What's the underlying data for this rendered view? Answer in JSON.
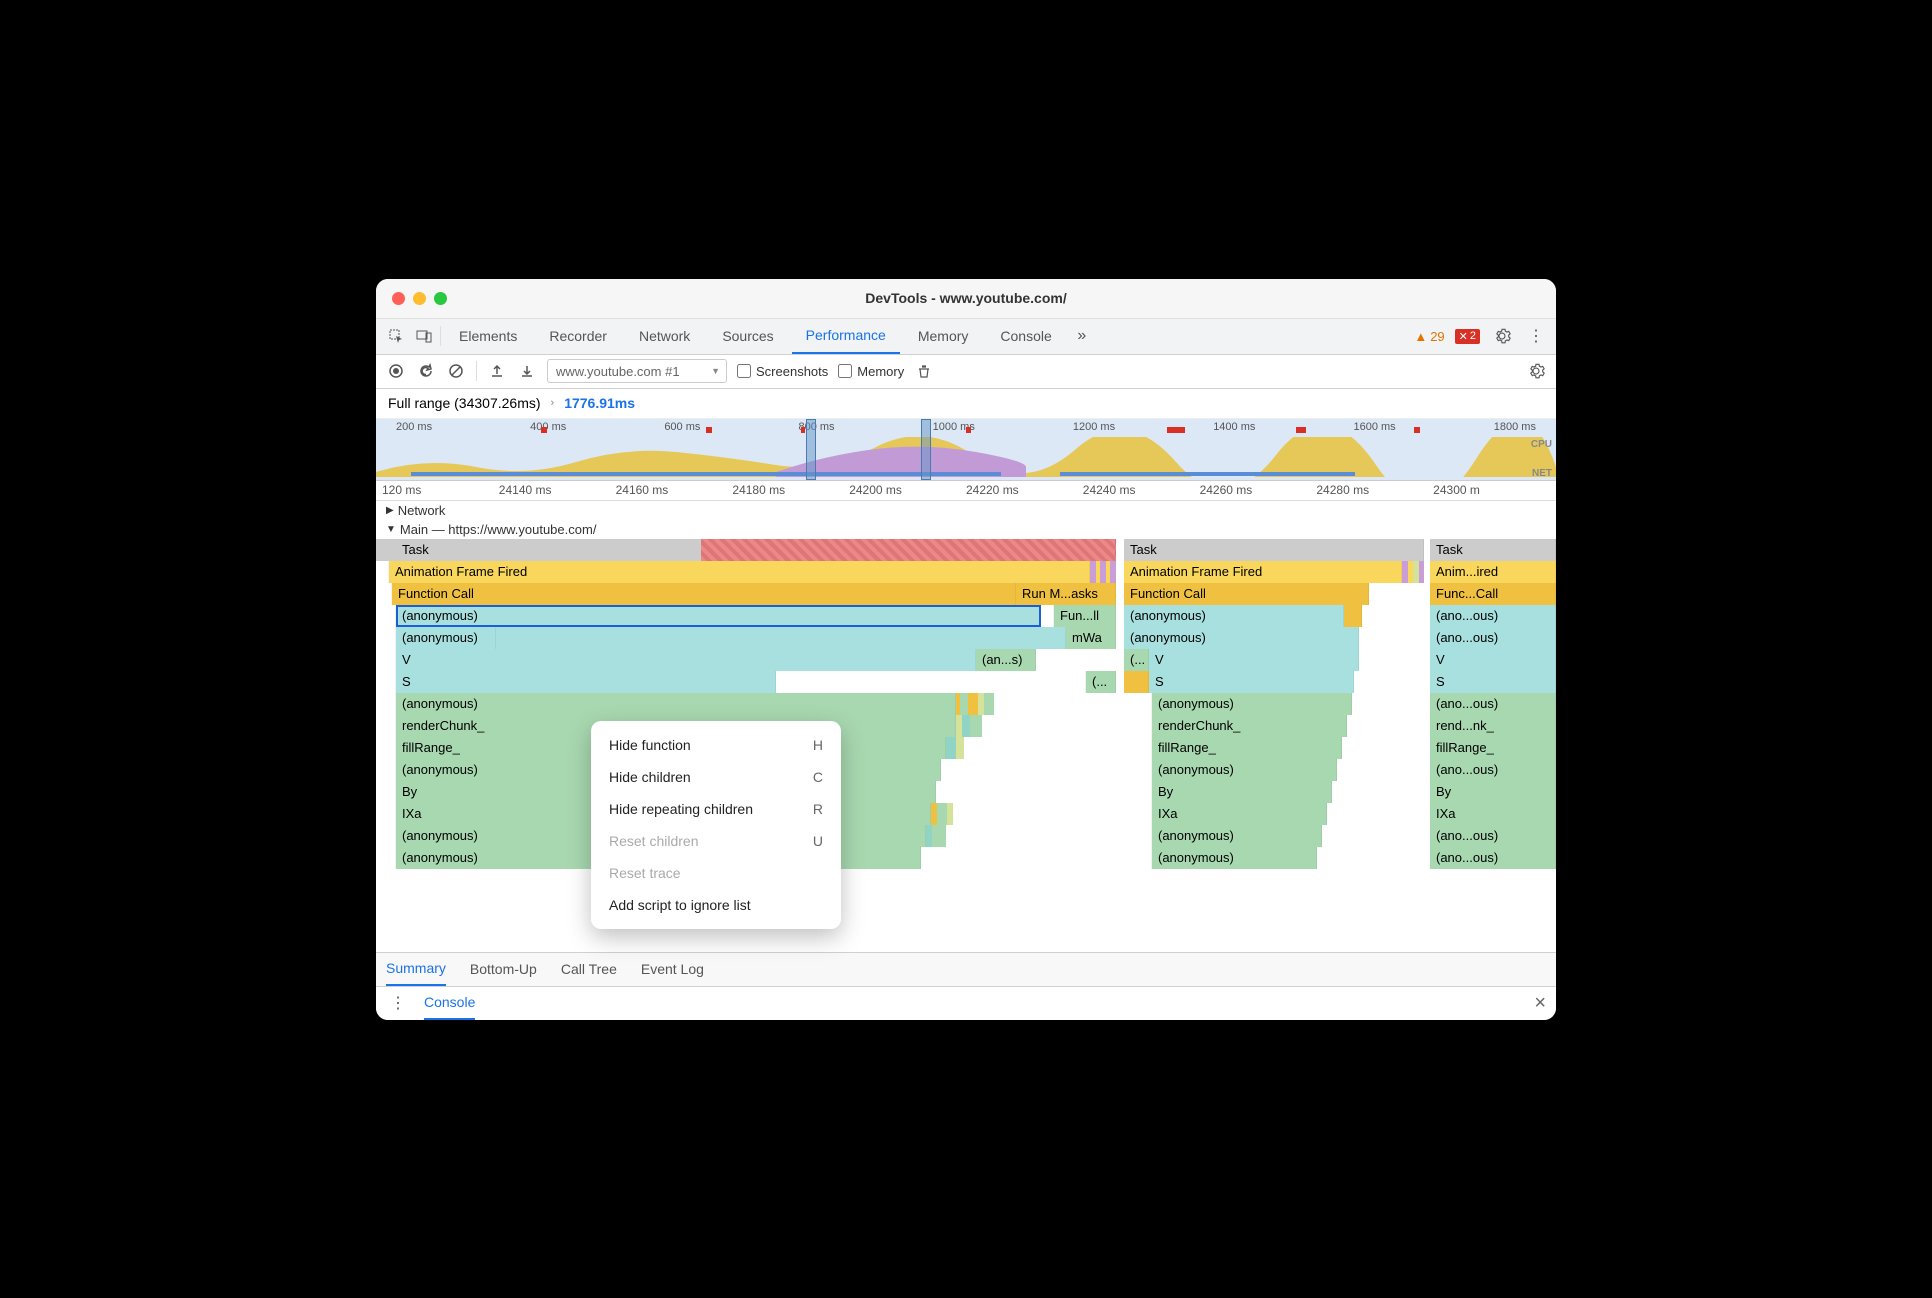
{
  "window": {
    "title": "DevTools - www.youtube.com/"
  },
  "topTabs": [
    "Elements",
    "Recorder",
    "Network",
    "Sources",
    "Performance",
    "Memory",
    "Console"
  ],
  "topActiveTab": "Performance",
  "counters": {
    "warnings": 29,
    "errors": 2
  },
  "recording_select": "www.youtube.com #1",
  "toolbar_checks": {
    "screenshots": "Screenshots",
    "memory": "Memory"
  },
  "breadcrumb": {
    "full": "Full range (34307.26ms)",
    "sel": "1776.91ms"
  },
  "overview_ticks": [
    "200 ms",
    "400 ms",
    "600 ms",
    "800 ms",
    "1000 ms",
    "1200 ms",
    "1400 ms",
    "1600 ms",
    "1800 ms"
  ],
  "overview_labels": {
    "cpu": "CPU",
    "net": "NET"
  },
  "detail_ticks": [
    "120 ms",
    "24140 ms",
    "24160 ms",
    "24180 ms",
    "24200 ms",
    "24220 ms",
    "24240 ms",
    "24260 ms",
    "24280 ms",
    "24300 m"
  ],
  "sections": {
    "network": "Network",
    "main": "Main — https://www.youtube.com/"
  },
  "flame": {
    "task": "Task",
    "animFrame": "Animation Frame Fired",
    "animShort": "Anim...ired",
    "funcCall": "Function Call",
    "funcShort": "Func...Call",
    "runM": "Run M...asks",
    "anon": "(anonymous)",
    "anonShort": "(ano...ous)",
    "funll": "Fun...ll",
    "mWa": "mWa",
    "ans": "(an...s)",
    "paren": "(...",
    "V": "V",
    "S": "S",
    "dotparen": "(...",
    "renderChunk": "renderChunk_",
    "renderShort": "rend...nk_",
    "fillRange": "fillRange_",
    "By": "By",
    "IXa": "IXa"
  },
  "context_menu": [
    {
      "label": "Hide function",
      "key": "H",
      "enabled": true
    },
    {
      "label": "Hide children",
      "key": "C",
      "enabled": true
    },
    {
      "label": "Hide repeating children",
      "key": "R",
      "enabled": true
    },
    {
      "label": "Reset children",
      "key": "U",
      "enabled": false
    },
    {
      "label": "Reset trace",
      "key": "",
      "enabled": false
    },
    {
      "label": "Add script to ignore list",
      "key": "",
      "enabled": true
    }
  ],
  "bottom_tabs": [
    "Summary",
    "Bottom-Up",
    "Call Tree",
    "Event Log"
  ],
  "bottom_active": "Summary",
  "drawer": {
    "tab": "Console"
  }
}
